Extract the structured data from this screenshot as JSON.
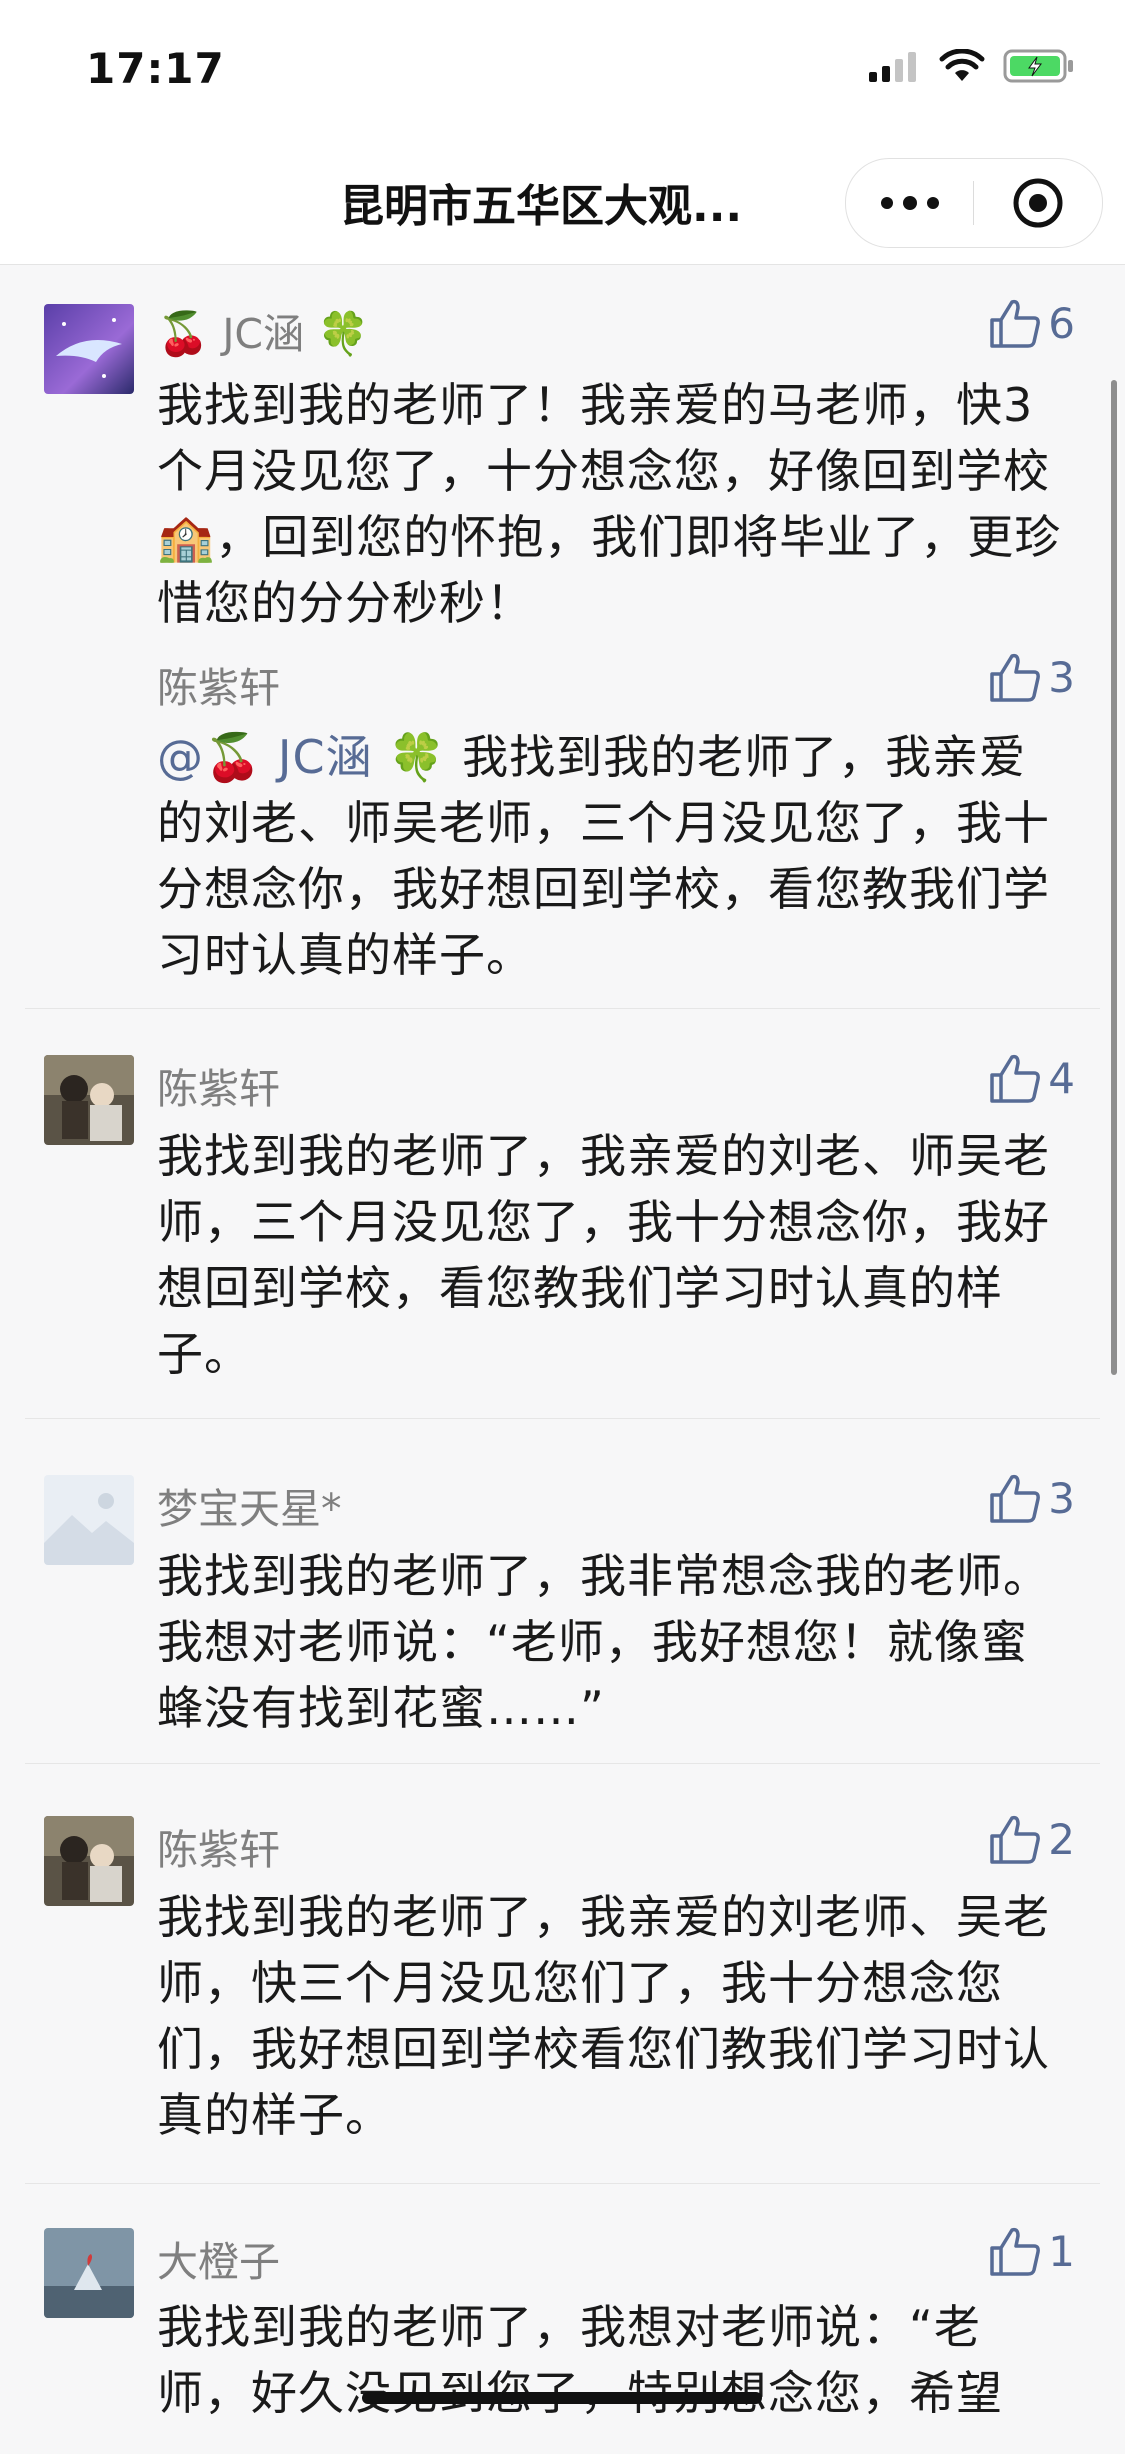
{
  "status_bar": {
    "time": "17:17"
  },
  "nav": {
    "title": "昆明市五华区大观..."
  },
  "comments": [
    {
      "name": "JC涵",
      "likes": "6",
      "text": "我找到我的老师了！我亲爱的马老师，快3个月没见您了，十分想念您，好像回到学校🏫，回到您的怀抱，我们即将毕业了，更珍惜您的分分秒秒！",
      "reply": {
        "name": "陈紫轩",
        "likes": "3",
        "mention": "@🍒 JC涵 🍀",
        "text": "我找到我的老师了，我亲爱的刘老、师吴老师，三个月没见您了，我十分想念你，我好想回到学校，看您教我们学习时认真的样子。"
      }
    },
    {
      "name": "陈紫轩",
      "likes": "4",
      "text": "我找到我的老师了，我亲爱的刘老、师吴老师，三个月没见您了，我十分想念你，我好想回到学校，看您教我们学习时认真的样子。"
    },
    {
      "name": "梦宝天星*",
      "likes": "3",
      "text": "我找到我的老师了，我非常想念我的老师。我想对老师说：“老师，我好想您！就像蜜蜂没有找到花蜜……”"
    },
    {
      "name": "陈紫轩",
      "likes": "2",
      "text": "我找到我的老师了，我亲爱的刘老师、吴老师，快三个月没见您们了，我十分想念您们，我好想回到学校看您们教我们学习时认真的样子。"
    },
    {
      "name": "大橙子",
      "likes": "1",
      "text": "我找到我的老师了，我想对老师说：“老师，好久没见到您了，特别想念您，希望"
    }
  ],
  "colors": {
    "link": "#576b95",
    "name": "#7f7f7f",
    "background": "#f7f7f8"
  },
  "icons": {
    "like": "thumbs-up-icon",
    "more": "more-dots-icon",
    "close": "close-mini-program-icon"
  }
}
